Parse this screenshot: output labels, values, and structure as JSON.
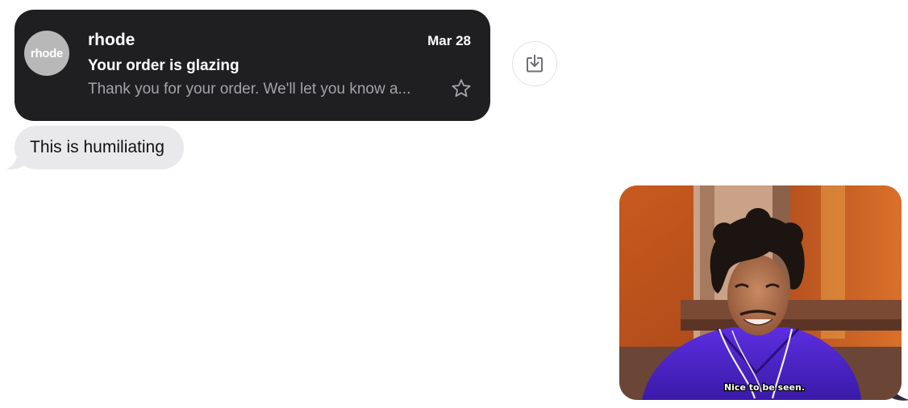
{
  "email": {
    "avatar_text": "rhode",
    "sender": "rhode",
    "date": "Mar 28",
    "subject": "Your order is glazing",
    "preview": "Thank you for your order. We'll let you know a..."
  },
  "icons": {
    "star": "star-icon",
    "save": "save-to-device-icon"
  },
  "messages": {
    "received": [
      {
        "text": "This is humiliating"
      }
    ],
    "sent_gif": {
      "caption": "Nice to be seen."
    }
  },
  "colors": {
    "card_bg": "#1f1f21",
    "received_bubble": "#e9e9eb",
    "preview_text": "#a3a3a8"
  }
}
